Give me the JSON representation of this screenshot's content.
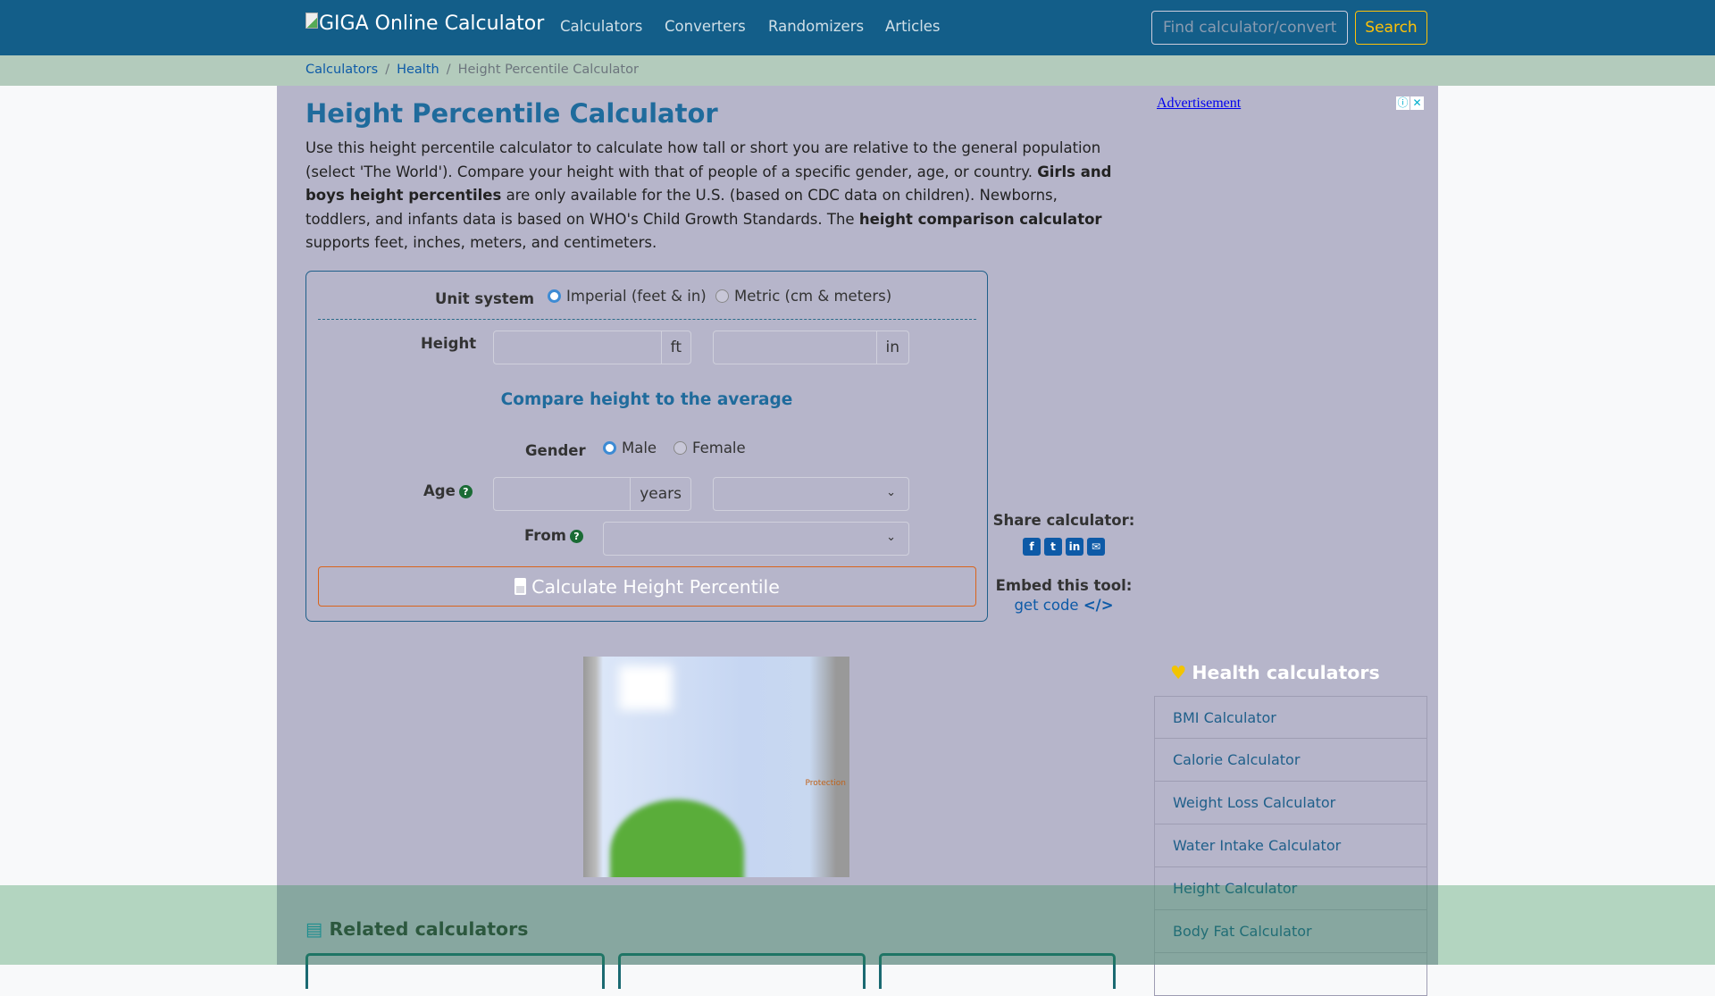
{
  "nav": {
    "logo_alt": "GIGA Online Calculator",
    "links": [
      "Calculators",
      "Converters",
      "Randomizers",
      "Articles"
    ],
    "search_placeholder": "Find calculator/converter",
    "search_button": "Search"
  },
  "breadcrumb": [
    "Calculators",
    "Health",
    "Height Percentile Calculator"
  ],
  "page": {
    "title": "Height Percentile Calculator",
    "intro": [
      {
        "t": "Use this height percentile calculator to calculate how tall or short you are relative to the general population (select 'The World'). Compare your height with that of people of a specific gender, age, or country. ",
        "b": false
      },
      {
        "t": "Girls and boys height percentiles",
        "b": true
      },
      {
        "t": " are only available for the U.S. (based on CDC data on children). Newborns, toddlers, and infants data is based on WHO's Child Growth Standards. The ",
        "b": false
      },
      {
        "t": "height comparison calculator",
        "b": true
      },
      {
        "t": " supports feet, inches, meters, and centimeters.",
        "b": false
      }
    ]
  },
  "form": {
    "unit_label": "Unit system",
    "unit_options": [
      "Imperial (feet & in)",
      "Metric (cm & meters)"
    ],
    "unit_selected": "Imperial (feet & in)",
    "height_label": "Height",
    "height_ft": "",
    "height_in": "",
    "ft_unit": "ft",
    "in_unit": "in",
    "compare_heading": "Compare height to the average",
    "gender_label": "Gender",
    "gender_options": [
      "Male",
      "Female"
    ],
    "gender_selected": "Male",
    "age_label": "Age",
    "age_value": "",
    "age_unit": "years",
    "age_select": "",
    "from_label": "From",
    "from_select": "",
    "help": "?",
    "calculate_button": "Calculate Height Percentile"
  },
  "share": {
    "label": "Share calculator:",
    "icons": [
      "facebook-icon",
      "twitter-icon",
      "linkedin-icon",
      "email-icon"
    ],
    "embed_label": "Embed this tool:",
    "get_code": "get code"
  },
  "ad": {
    "link": "Advertisement",
    "image_text": "Protection"
  },
  "health": {
    "heading": "Health calculators",
    "items": [
      "BMI Calculator",
      "Calorie Calculator",
      "Weight Loss Calculator",
      "Water Intake Calculator",
      "Height Calculator",
      "Body Fat Calculator"
    ]
  },
  "related": {
    "heading": "Related calculators"
  }
}
